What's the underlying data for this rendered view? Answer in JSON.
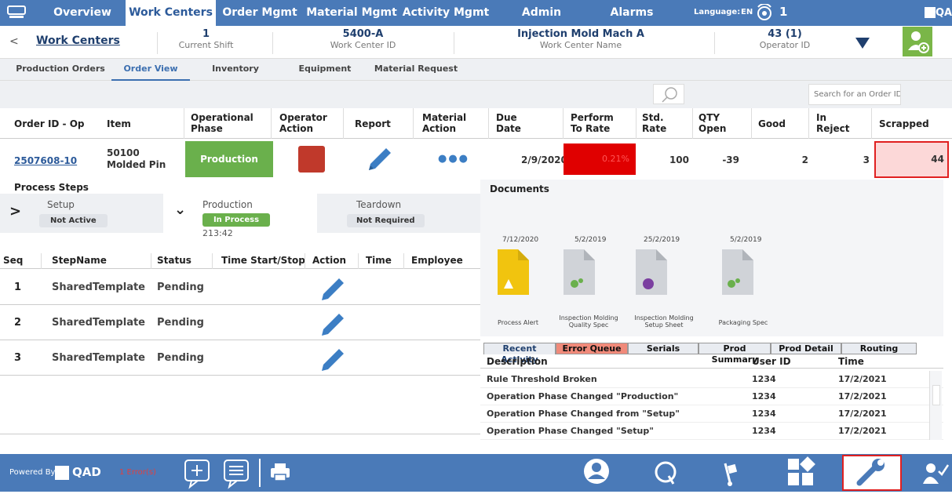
{
  "nav": {
    "tabs": [
      "Overview",
      "Work Centers",
      "Order Mgmt",
      "Material Mgmt",
      "Activity Mgmt",
      "Admin",
      "Alarms"
    ],
    "language_label": "Language:",
    "language_value": "EN",
    "alarm_count": "1",
    "brand": "QAD"
  },
  "header": {
    "back": "<",
    "title": "Work Centers",
    "shift_value": "1",
    "shift_label": "Current Shift",
    "wc_id_value": "5400-A",
    "wc_id_label": "Work Center ID",
    "wc_name_value": "Injection Mold Mach A",
    "wc_name_label": "Work Center Name",
    "operator_value": "43 (1)",
    "operator_label": "Operator ID"
  },
  "subtabs": [
    "Production Orders",
    "Order View",
    "Inventory",
    "Equipment",
    "Material Request"
  ],
  "search": {
    "placeholder": "Search for an Order ID..."
  },
  "columns": [
    "Order ID - Op",
    "Item",
    "Operational Phase",
    "Operator Action",
    "Report",
    "Material Action",
    "Due Date",
    "Perform To Rate",
    "Std. Rate",
    "QTY Open",
    "Good",
    "In Reject",
    "Scrapped"
  ],
  "order": {
    "id": "2507608-10",
    "item_code": "50100",
    "item_name": "Molded Pin",
    "phase": "Production",
    "material_action": "●●●",
    "due": "2/9/2020",
    "perform": "0.21%",
    "std_rate": "100",
    "qty_open": "-39",
    "good": "2",
    "reject": "3",
    "scrapped": "44"
  },
  "process": {
    "title": "Process Steps",
    "steps": [
      {
        "name": "Setup",
        "status": "Not Active",
        "toggle": ">"
      },
      {
        "name": "Production",
        "status": "In Process",
        "time": "213:42",
        "toggle": "⌄"
      },
      {
        "name": "Teardown",
        "status": "Not Required"
      }
    ]
  },
  "steps_table": {
    "headers": [
      "Seq",
      "StepName",
      "Status",
      "Time Start/Stop",
      "Action",
      "Time",
      "Employee"
    ],
    "rows": [
      {
        "seq": "1",
        "name": "SharedTemplate",
        "status": "Pending"
      },
      {
        "seq": "2",
        "name": "SharedTemplate",
        "status": "Pending"
      },
      {
        "seq": "3",
        "name": "SharedTemplate",
        "status": "Pending"
      }
    ]
  },
  "documents": {
    "title": "Documents",
    "items": [
      {
        "date": "7/12/2020",
        "name": "Process Alert"
      },
      {
        "date": "5/2/2019",
        "name": "Inspection Molding Quality Spec"
      },
      {
        "date": "25/2/2019",
        "name": "Inspection Molding Setup Sheet"
      },
      {
        "date": "5/2/2019",
        "name": "Packaging Spec"
      }
    ]
  },
  "activity": {
    "tabs": [
      "Recent Activity",
      "Error Queue",
      "Serials",
      "Prod Summary",
      "Prod Detail",
      "Routing"
    ],
    "headers": [
      "Description",
      "User ID",
      "Time"
    ],
    "rows": [
      {
        "desc": "Rule Threshold Broken",
        "user": "1234",
        "time": "17/2/2021"
      },
      {
        "desc": "Operation Phase Changed \"Production\"",
        "user": "1234",
        "time": "17/2/2021"
      },
      {
        "desc": "Operation Phase Changed from \"Setup\"",
        "user": "1234",
        "time": "17/2/2021"
      },
      {
        "desc": "Operation Phase Changed \"Setup\"",
        "user": "1234",
        "time": "17/2/2021"
      }
    ]
  },
  "footer": {
    "powered": "Powered By",
    "brand": "QAD",
    "errors": "1 Error(s)"
  },
  "colors": {
    "nav": "#4a7ab8",
    "green": "#6ab04c",
    "red": "#e00000",
    "stop": "#c0392b",
    "highlight": "#e02020"
  }
}
